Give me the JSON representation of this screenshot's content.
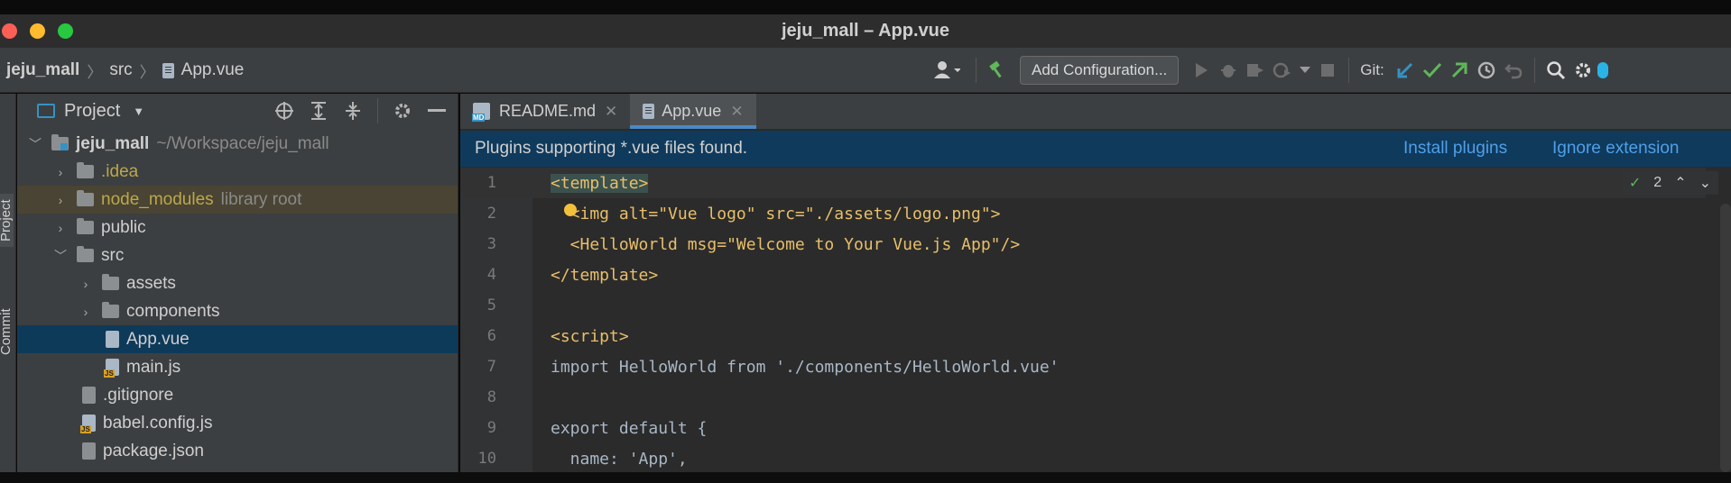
{
  "window": {
    "title": "jeju_mall – App.vue"
  },
  "breadcrumbs": [
    {
      "label": "jeju_mall"
    },
    {
      "label": "src"
    },
    {
      "label": "App.vue"
    }
  ],
  "toolbar": {
    "add_configuration": "Add Configuration...",
    "git_label": "Git:"
  },
  "leftstrip": {
    "project_tab": "Project",
    "commit_tab": "Commit"
  },
  "project_panel": {
    "title": "Project",
    "tree": [
      {
        "name": "jeju_mall",
        "hint": "~/Workspace/jeju_mall",
        "kind": "module",
        "expanded": true
      },
      {
        "name": ".idea",
        "kind": "folder"
      },
      {
        "name": "node_modules",
        "hint": "library root",
        "kind": "folder"
      },
      {
        "name": "public",
        "kind": "folder"
      },
      {
        "name": "src",
        "kind": "folder",
        "expanded": true
      },
      {
        "name": "assets",
        "kind": "folder"
      },
      {
        "name": "components",
        "kind": "folder"
      },
      {
        "name": "App.vue",
        "kind": "file",
        "selected": true
      },
      {
        "name": "main.js",
        "kind": "js"
      },
      {
        "name": ".gitignore",
        "kind": "file"
      },
      {
        "name": "babel.config.js",
        "kind": "js"
      },
      {
        "name": "package.json",
        "kind": "file"
      }
    ]
  },
  "editor": {
    "tabs": [
      {
        "label": "README.md",
        "active": false
      },
      {
        "label": "App.vue",
        "active": true
      }
    ],
    "banner": {
      "message": "Plugins supporting *.vue files found.",
      "install": "Install plugins",
      "ignore": "Ignore extension"
    },
    "inspection_count": "2",
    "line_numbers": [
      "1",
      "2",
      "3",
      "4",
      "5",
      "6",
      "7",
      "8",
      "9",
      "10"
    ],
    "lines": {
      "l1": "<template>",
      "l2": "  <img alt=\"Vue logo\" src=\"./assets/logo.png\">",
      "l3": "  <HelloWorld msg=\"Welcome to Your Vue.js App\"/>",
      "l4": "</template>",
      "l5": "",
      "l6": "<script>",
      "l7": "import HelloWorld from './components/HelloWorld.vue'",
      "l8": "",
      "l9": "export default {",
      "l10": "  name: 'App',"
    }
  },
  "colors": {
    "accent": "#4a88c7",
    "banner_bg": "#0f3a5c",
    "selected_row": "#0e3a5a",
    "git_update": "#3592c4",
    "git_commit": "#5fb85a",
    "git_push": "#5fb85a"
  }
}
